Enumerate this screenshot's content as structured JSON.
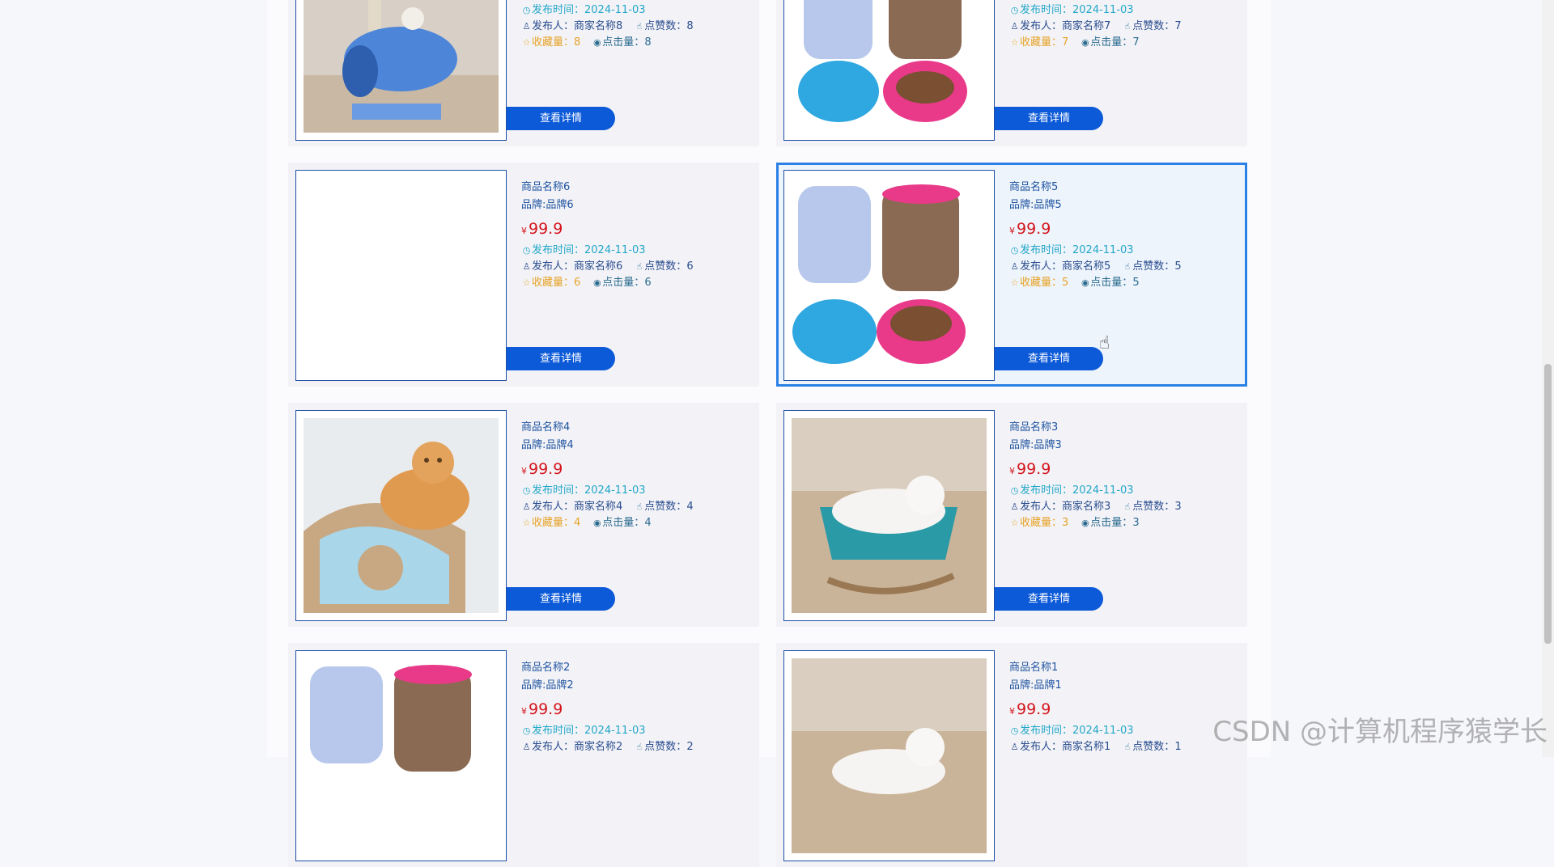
{
  "buttons": {
    "detail": "查看详情"
  },
  "labels": {
    "publish_time": "发布时间：",
    "publisher": "发布人：",
    "likes": "点赞数：",
    "favorites": "收藏量：",
    "views": "点击量："
  },
  "currency": "¥",
  "products": [
    {
      "time": "2024-11-03",
      "publisher": "商家名称8",
      "likes": "8",
      "favorites": "8",
      "views": "8"
    },
    {
      "time": "2024-11-03",
      "publisher": "商家名称7",
      "likes": "7",
      "favorites": "7",
      "views": "7"
    },
    {
      "name": "商品名称6",
      "brand": "品牌:品牌6",
      "price": "99.9",
      "time": "2024-11-03",
      "publisher": "商家名称6",
      "likes": "6",
      "favorites": "6",
      "views": "6"
    },
    {
      "name": "商品名称5",
      "brand": "品牌:品牌5",
      "price": "99.9",
      "time": "2024-11-03",
      "publisher": "商家名称5",
      "likes": "5",
      "favorites": "5",
      "views": "5"
    },
    {
      "name": "商品名称4",
      "brand": "品牌:品牌4",
      "price": "99.9",
      "time": "2024-11-03",
      "publisher": "商家名称4",
      "likes": "4",
      "favorites": "4",
      "views": "4"
    },
    {
      "name": "商品名称3",
      "brand": "品牌:品牌3",
      "price": "99.9",
      "time": "2024-11-03",
      "publisher": "商家名称3",
      "likes": "3",
      "favorites": "3",
      "views": "3"
    },
    {
      "name": "商品名称2",
      "brand": "品牌:品牌2",
      "price": "99.9",
      "time": "2024-11-03",
      "publisher": "商家名称2",
      "likes": "2"
    },
    {
      "name": "商品名称1",
      "brand": "品牌:品牌1",
      "price": "99.9",
      "time": "2024-11-03",
      "publisher": "商家名称1",
      "likes": "1"
    }
  ],
  "watermark": "CSDN @计算机程序猿学长",
  "colors": {
    "accent": "#0c5ad8",
    "price": "#d4151c",
    "active_border": "#2b80e6"
  }
}
